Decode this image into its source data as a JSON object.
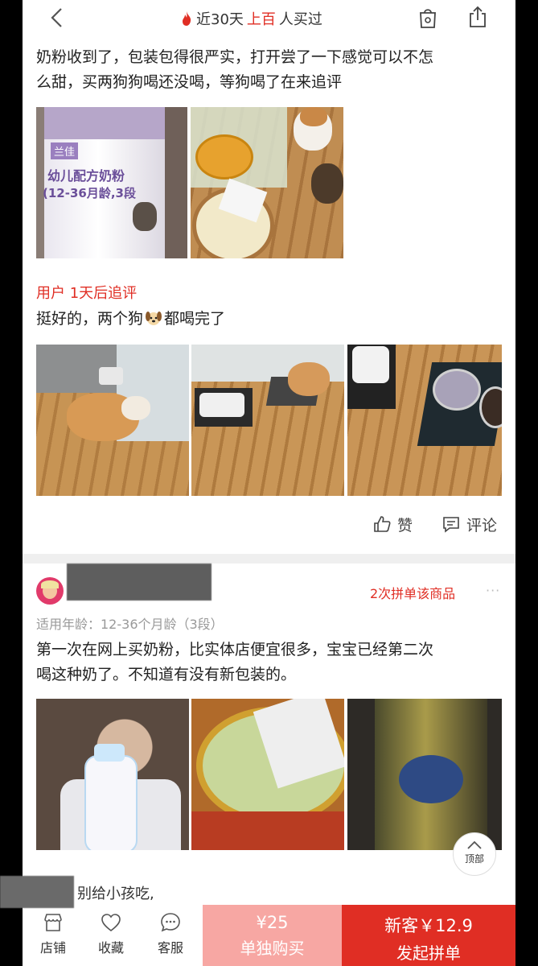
{
  "top_bar": {
    "banner_prefix": "近30天",
    "banner_highlight": "上百",
    "banner_suffix": "人买过",
    "icons": [
      "back-arrow-icon",
      "flame-icon",
      "shop-icon",
      "share-icon"
    ]
  },
  "review1": {
    "text_line1": "奶粉收到了，包装包得很严实，打开尝了一下感觉可以不怎",
    "text_line2": "么甜，买两狗狗喝还没喝，等狗喝了在来追评",
    "can_brand": "兰佳",
    "can_line1": "幼儿配方奶粉",
    "can_line2": "(12-36月龄,3段",
    "followup_label": "用户 1天后追评",
    "followup_text_before": "挺好的，两个狗",
    "followup_text_after": "都喝完了",
    "like_label": "赞",
    "comment_label": "评论"
  },
  "review2": {
    "purchase_count": "2次拼单该商品",
    "more": "···",
    "spec": "适用年龄：12-36个月龄（3段）",
    "text_line1": "第一次在网上买奶粉，比实体店便宜很多，宝宝已经第二次",
    "text_line2": "喝这种奶了。不知道有没有新包装的。"
  },
  "back_to_top": "顶部",
  "reply_text": "别给小孩吃,",
  "bottom_bar": {
    "store": "店铺",
    "favorite": "收藏",
    "service": "客服",
    "single_price": "¥25",
    "single_label": "单独购买",
    "group_price": "新客￥12.9",
    "group_label": "发起拼单"
  },
  "colors": {
    "accent": "#e02e24",
    "single_buy_bg": "#f7a7a3",
    "background": "#efefef"
  }
}
